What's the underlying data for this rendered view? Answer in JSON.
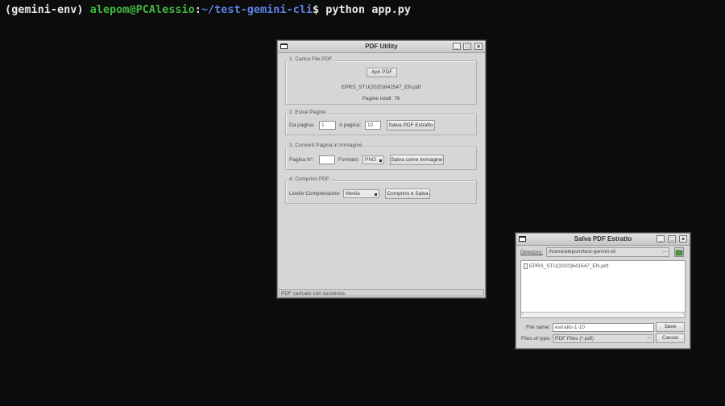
{
  "terminal": {
    "env": "(gemini-env) ",
    "user_host": "alepom@PCAlessio",
    "colon": ":",
    "path": "~/test-gemini-cli",
    "dollar": "$ ",
    "command": "python app.py"
  },
  "pdf_utility": {
    "title": "PDF Utility",
    "load_section": {
      "title": "1. Carica File PDF",
      "open_button": "Apri PDF",
      "file_name": "EPRS_STU(2020)641547_EN.pdf",
      "total_pages": "Pagine totali: 76"
    },
    "extract_section": {
      "title": "2. Estrai Pagine",
      "from_label": "Da pagina:",
      "from_value": "1",
      "to_label": "A pagina:",
      "to_value": "10",
      "save_button": "Salva PDF Estratto"
    },
    "convert_section": {
      "title": "3. Converti Pagina in Immagine",
      "page_label": "Pagina N°:",
      "page_value": "",
      "format_label": "Formato:",
      "format_value": "PNG",
      "save_button": "Salva come Immagine"
    },
    "compress_section": {
      "title": "4. Comprimi PDF",
      "level_label": "Livello Compressione:",
      "level_value": "Media",
      "button": "Comprimi e Salva"
    },
    "status": "PDF caricato con successo."
  },
  "save_dialog": {
    "title": "Salva PDF Estratto",
    "directory_label": "Directory:",
    "directory_value": "/home/alepom/test-gemini-cli",
    "files": [
      "EPRS_STU(2020)641547_EN.pdf"
    ],
    "file_name_label": "File name:",
    "file_name_value": "estratto-1-10",
    "save_button": "Save",
    "type_label": "Files of type:",
    "type_value": "PDF Files (*.pdf)",
    "cancel_button": "Cancel"
  }
}
